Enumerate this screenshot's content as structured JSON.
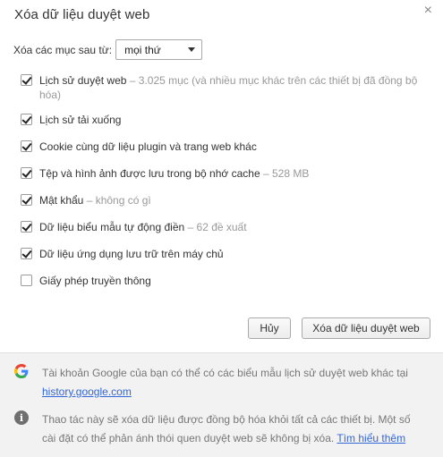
{
  "dialog": {
    "title": "Xóa dữ liệu duyệt web",
    "close_glyph": "×"
  },
  "time_range": {
    "label": "Xóa các mục sau từ:",
    "selected": "mọi thứ"
  },
  "options": [
    {
      "label": "Lịch sử duyệt web",
      "detail": " – 3.025 mục (và nhiều mục khác trên các thiết bị đã đồng bộ hóa)",
      "checked": true
    },
    {
      "label": "Lịch sử tải xuống",
      "detail": "",
      "checked": true
    },
    {
      "label": "Cookie cùng dữ liệu plugin và trang web khác",
      "detail": "",
      "checked": true
    },
    {
      "label": "Tệp và hình ảnh được lưu trong bộ nhớ cache",
      "detail": " – 528 MB",
      "checked": true
    },
    {
      "label": "Mật khẩu",
      "detail": " – không có gì",
      "checked": true
    },
    {
      "label": "Dữ liệu biểu mẫu tự động điền",
      "detail": " – 62 đề xuất",
      "checked": true
    },
    {
      "label": "Dữ liệu ứng dụng lưu trữ trên máy chủ",
      "detail": "",
      "checked": true
    },
    {
      "label": "Giấy phép truyền thông",
      "detail": "",
      "checked": false
    }
  ],
  "buttons": {
    "cancel": "Hủy",
    "confirm": "Xóa dữ liệu duyệt web"
  },
  "footer": {
    "google_note": "Tài khoản Google của bạn có thể có các biểu mẫu lịch sử duyệt web khác tại",
    "google_link": "history.google.com",
    "sync_note": "Thao tác này sẽ xóa dữ liệu được đồng bộ hóa khỏi tất cả các thiết bị. Một số cài đặt có thể phản ánh thói quen duyệt web sẽ không bị xóa.",
    "learn_more": "Tìm hiểu thêm",
    "info_glyph": "i"
  },
  "icons": {
    "google": "google-g-icon",
    "info": "info-icon",
    "close": "close-icon"
  }
}
